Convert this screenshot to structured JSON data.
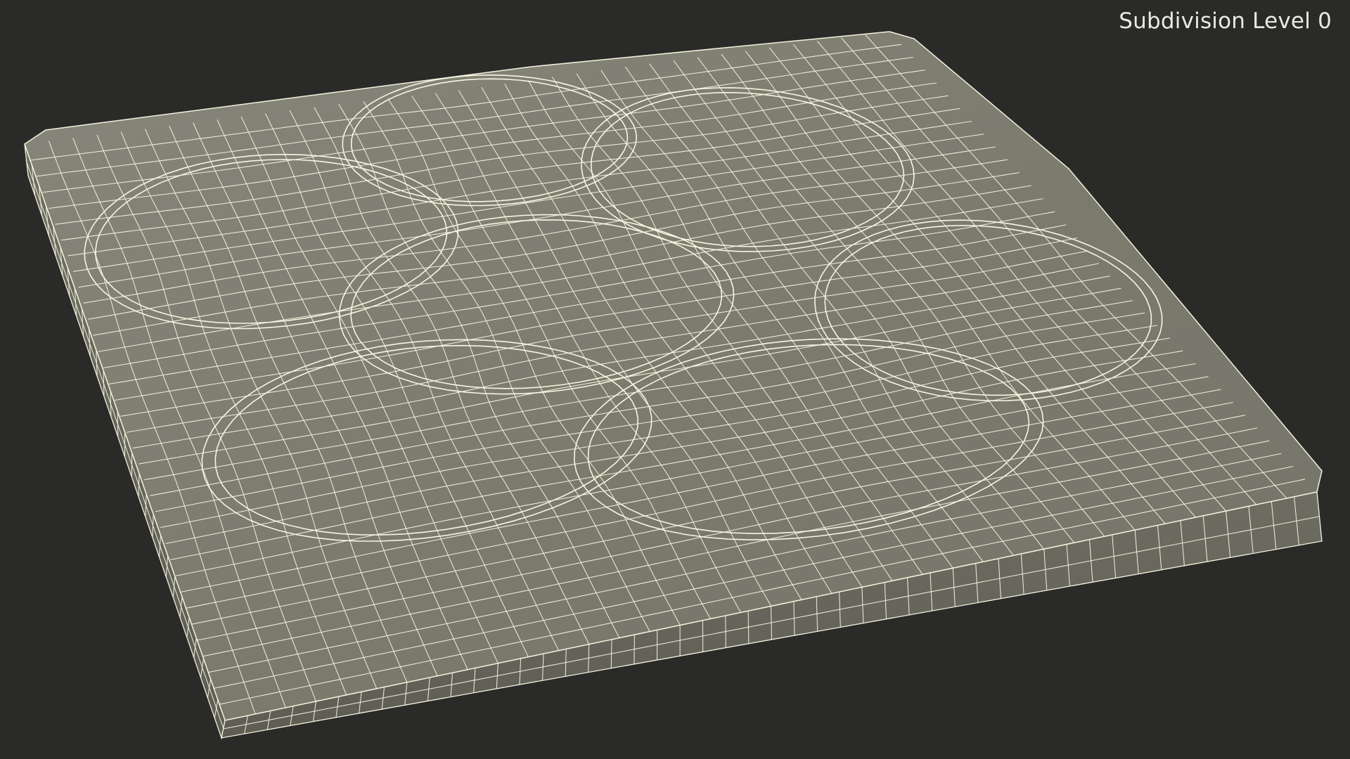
{
  "viewport": {
    "label": "Subdivision Level 0",
    "background_color": "#2a2a29",
    "mesh_fill_color": "#7b7b6e",
    "mesh_edge_color": "#f4f2dc"
  },
  "model": {
    "display_mode": "wireframe-on-shaded"
  }
}
